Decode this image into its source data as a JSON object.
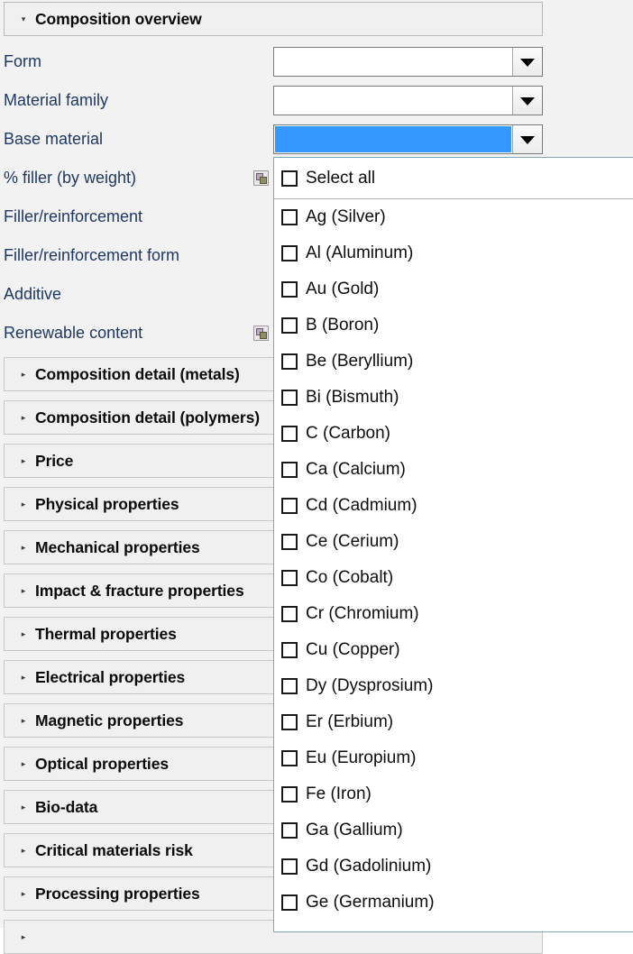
{
  "panel": {
    "header": {
      "title": "Composition overview",
      "expanded_marker": "▾"
    },
    "fields": [
      {
        "label": "Form",
        "control": "combobox",
        "value": "",
        "selected": false,
        "has_range_icon": false
      },
      {
        "label": "Material family",
        "control": "combobox",
        "value": "",
        "selected": false,
        "has_range_icon": false
      },
      {
        "label": "Base material",
        "control": "combobox",
        "value": "",
        "selected": true,
        "has_range_icon": false
      },
      {
        "label": "% filler (by weight)",
        "control": "range",
        "value": "",
        "selected": false,
        "has_range_icon": true
      },
      {
        "label": "Filler/reinforcement",
        "control": "combobox",
        "value": "",
        "selected": false,
        "has_range_icon": false
      },
      {
        "label": "Filler/reinforcement form",
        "control": "combobox",
        "value": "",
        "selected": false,
        "has_range_icon": false
      },
      {
        "label": "Additive",
        "control": "combobox",
        "value": "",
        "selected": false,
        "has_range_icon": false
      },
      {
        "label": "Renewable content",
        "control": "range",
        "value": "",
        "selected": false,
        "has_range_icon": true
      }
    ],
    "sections": [
      {
        "label": "Composition detail (metals)",
        "expanded": false,
        "marker": "▸"
      },
      {
        "label": "Composition detail (polymers)",
        "expanded": false,
        "marker": "▸"
      },
      {
        "label": "Price",
        "expanded": false,
        "marker": "▸"
      },
      {
        "label": "Physical properties",
        "expanded": false,
        "marker": "▸"
      },
      {
        "label": "Mechanical properties",
        "expanded": false,
        "marker": "▸"
      },
      {
        "label": "Impact & fracture properties",
        "expanded": false,
        "marker": "▸"
      },
      {
        "label": "Thermal properties",
        "expanded": false,
        "marker": "▸"
      },
      {
        "label": "Electrical properties",
        "expanded": false,
        "marker": "▸"
      },
      {
        "label": "Magnetic properties",
        "expanded": false,
        "marker": "▸"
      },
      {
        "label": "Optical properties",
        "expanded": false,
        "marker": "▸"
      },
      {
        "label": "Bio-data",
        "expanded": false,
        "marker": "▸"
      },
      {
        "label": "Critical materials risk",
        "expanded": false,
        "marker": "▸"
      },
      {
        "label": "Processing properties",
        "expanded": false,
        "marker": "▸"
      },
      {
        "label": "",
        "expanded": false,
        "marker": "▸"
      }
    ]
  },
  "popup": {
    "select_all_label": "Select all",
    "options": [
      {
        "label": "Ag (Silver)",
        "checked": false
      },
      {
        "label": "Al (Aluminum)",
        "checked": false
      },
      {
        "label": "Au (Gold)",
        "checked": false
      },
      {
        "label": "B (Boron)",
        "checked": false
      },
      {
        "label": "Be (Beryllium)",
        "checked": false
      },
      {
        "label": "Bi (Bismuth)",
        "checked": false
      },
      {
        "label": "C (Carbon)",
        "checked": false
      },
      {
        "label": "Ca (Calcium)",
        "checked": false
      },
      {
        "label": "Cd (Cadmium)",
        "checked": false
      },
      {
        "label": "Ce (Cerium)",
        "checked": false
      },
      {
        "label": "Co (Cobalt)",
        "checked": false
      },
      {
        "label": "Cr (Chromium)",
        "checked": false
      },
      {
        "label": "Cu (Copper)",
        "checked": false
      },
      {
        "label": "Dy (Dysprosium)",
        "checked": false
      },
      {
        "label": "Er (Erbium)",
        "checked": false
      },
      {
        "label": "Eu (Europium)",
        "checked": false
      },
      {
        "label": "Fe (Iron)",
        "checked": false
      },
      {
        "label": "Ga (Gallium)",
        "checked": false
      },
      {
        "label": "Gd (Gadolinium)",
        "checked": false
      },
      {
        "label": "Ge (Germanium)",
        "checked": false
      }
    ]
  },
  "colors": {
    "label_text": "#1F3864",
    "selection_blue": "#3399FF",
    "popup_border": "#7AA7C7",
    "panel_bg": "#F2F2F2",
    "section_bg": "#F0F0F0"
  }
}
